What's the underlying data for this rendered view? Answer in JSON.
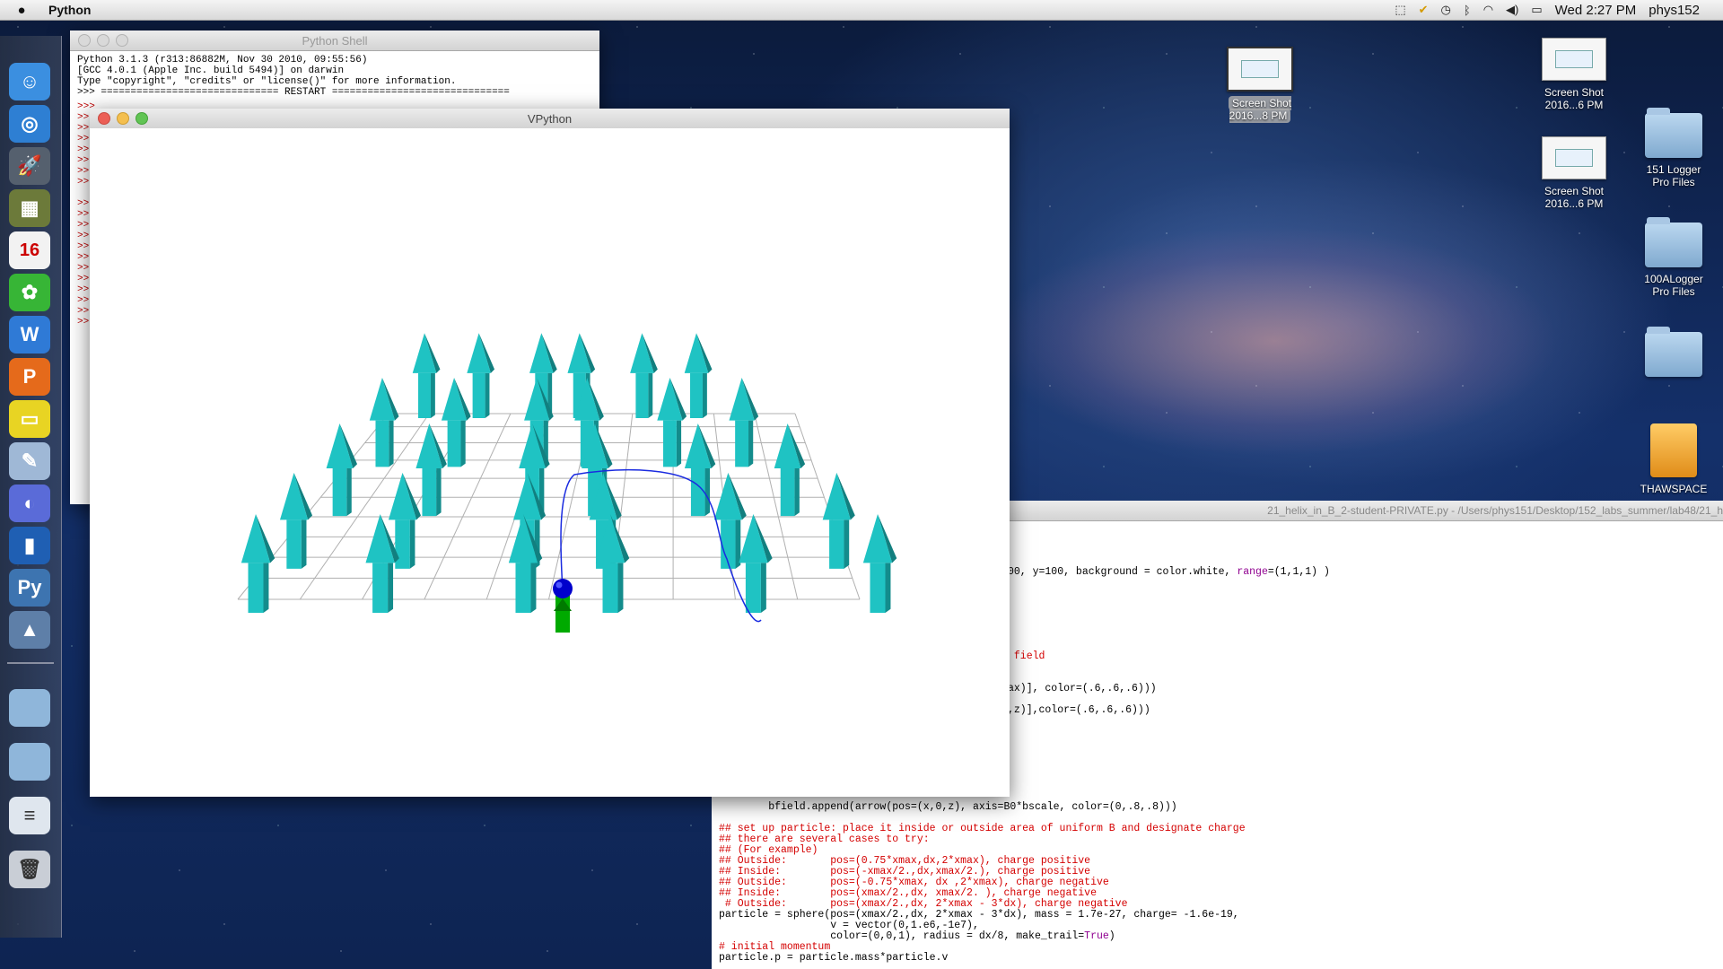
{
  "menubar": {
    "app_name": "Python",
    "clock": "Wed 2:27 PM",
    "user": "phys152"
  },
  "dock": {
    "items": [
      {
        "name": "finder-icon",
        "color": "#3b8fe0",
        "glyph": "☺"
      },
      {
        "name": "safari-icon",
        "color": "#2e7fd3",
        "glyph": "◎"
      },
      {
        "name": "launchpad-icon",
        "color": "#55606e",
        "glyph": "🚀"
      },
      {
        "name": "iphoto-icon",
        "color": "#6c7a3a",
        "glyph": "▦"
      },
      {
        "name": "calendar-icon",
        "color": "#f2f2f2",
        "glyph": "16"
      },
      {
        "name": "xgrid-icon",
        "color": "#37b536",
        "glyph": "✿"
      },
      {
        "name": "word-icon",
        "color": "#2f7ad6",
        "glyph": "W"
      },
      {
        "name": "powerpoint-icon",
        "color": "#e56a1b",
        "glyph": "P"
      },
      {
        "name": "labpro-icon",
        "color": "#e8d423",
        "glyph": "▭"
      },
      {
        "name": "preview-icon",
        "color": "#9fb8d6",
        "glyph": "✎"
      },
      {
        "name": "vlc-icon",
        "color": "#5a6bd8",
        "glyph": "◐"
      },
      {
        "name": "audio-icon",
        "color": "#1f5fb3",
        "glyph": "▮"
      },
      {
        "name": "python-icon",
        "color": "#3d74b0",
        "glyph": "Py"
      },
      {
        "name": "idle-icon",
        "color": "#5e7fa8",
        "glyph": "▲"
      }
    ],
    "bottom": [
      {
        "name": "folder-icon",
        "color": "#8fb6da",
        "glyph": ""
      },
      {
        "name": "folder-icon",
        "color": "#8fb6da",
        "glyph": ""
      },
      {
        "name": "document-icon",
        "color": "#dfe6ee",
        "glyph": "≡"
      },
      {
        "name": "trash-icon",
        "color": "#c9ced6",
        "glyph": "🗑"
      }
    ]
  },
  "desktop": {
    "shot_selected": "Screen Shot\n2016...8 PM",
    "shot1": "Screen Shot\n2016...6 PM",
    "shot2": "Screen Shot\n2016...6 PM",
    "folder1": "151 Logger\nPro Files",
    "folder2": "100ALogger\nPro Files",
    "folder3": "",
    "drive": "THAWSPACE"
  },
  "shell": {
    "title": "Python Shell",
    "lines": "Python 3.1.3 (r313:86882M, Nov 30 2010, 09:55:56)\n[GCC 4.0.1 (Apple Inc. build 5494)] on darwin\nType \"copyright\", \"credits\" or \"license()\" for more information.\n>>> ============================== RESTART ==============================",
    "prompts": [
      ">>>",
      ">>",
      ">>",
      ">>",
      ">>",
      ">>",
      ">>",
      ">>",
      "",
      ">>",
      ">>",
      ">>",
      ">>",
      ">>",
      ">>",
      ">>",
      ">>",
      ">>",
      ">>",
      ">>",
      ">>"
    ]
  },
  "vpython": {
    "title": "VPython",
    "arrow_color": "#1fc3c3",
    "trail_color": "#1a2be0",
    "particle_color": "#0000cc",
    "momentum_color": "#00aa00"
  },
  "editor": {
    "title": "21_helix_in_B_2-student-PRIVATE.py - /Users/phys151/Desktop/152_labs_summer/lab48/21_h",
    "l1": "00, y=100, background = color.white, ",
    "l1b": "range",
    "l1c": "=(1,1,1) )",
    "l2": " field",
    "l3": "ax)], color=(.6,.6,.6)))",
    "l4": ",z)],color=(.6,.6,.6)))",
    "l5": "        bfield.append(arrow(pos=(x,0,z), axis=B0*bscale, color=(0,.8,.8)))",
    "c1": "## set up particle: place it inside or outside area of uniform B and designate charge",
    "c2": "## there are several cases to try:",
    "c3": "## (For example)",
    "c4": "## Outside:       pos=(0.75*xmax,dx,2*xmax), charge positive",
    "c5": "## Inside:        pos=(-xmax/2.,dx,xmax/2.), charge positive",
    "c6": "## Outside:       pos=(-0.75*xmax, dx ,2*xmax), charge negative",
    "c7": "## Inside:        pos=(xmax/2.,dx, xmax/2. ), charge negative",
    "c8": " # Outside:       pos=(xmax/2.,dx, 2*xmax - 3*dx), charge negative",
    "p1": "particle = sphere(pos=(xmax/2.,dx, 2*xmax - 3*dx), mass = 1.7e-27, charge= -1.6e-19,",
    "p2": "                  v = vector(0,1.e6,-1e7),",
    "p3a": "                  color=(0,0,1), radius = dx/8, make_trail=",
    "p3b": "True",
    "p3c": ")",
    "c9": "# initial momentum",
    "p4": "particle.p = particle.mass*particle.v"
  }
}
